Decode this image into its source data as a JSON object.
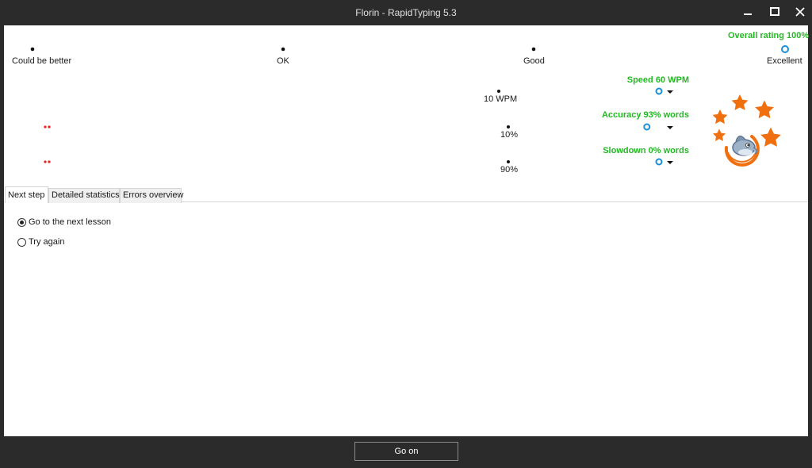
{
  "window": {
    "title": "Florin - RapidTyping 5.3"
  },
  "overall": {
    "label": "Overall rating 100%",
    "value_percent": 100,
    "scale_labels": [
      "Could be better",
      "OK",
      "Good",
      "Excellent"
    ]
  },
  "metrics": [
    {
      "label": "Speed 60 WPM",
      "tick_label": "10 WPM",
      "value_fraction": 1.0
    },
    {
      "label": "Accuracy 93% words",
      "tick_label": "10%",
      "value_fraction": 0.98
    },
    {
      "label": "Slowdown 0% words",
      "tick_label": "90%",
      "value_fraction": 1.0
    }
  ],
  "tabs": [
    {
      "label": "Next step",
      "active": true
    },
    {
      "label": "Detailed statistics",
      "active": false
    },
    {
      "label": "Errors overview",
      "active": false
    }
  ],
  "options": [
    {
      "label": "Go to the next lesson",
      "checked": true
    },
    {
      "label": "Try again",
      "checked": false
    }
  ],
  "footer": {
    "button_label": "Go on"
  },
  "colors": {
    "bad": "#e82020",
    "mid": "#e8e410",
    "good": "#20b020",
    "marker_ring": "#1a8fd8",
    "star": "#f07010",
    "label_green": "#22b922"
  },
  "icons": [
    "minimize-icon",
    "maximize-icon",
    "close-icon",
    "stars-icon",
    "dolphin-logo-icon"
  ]
}
